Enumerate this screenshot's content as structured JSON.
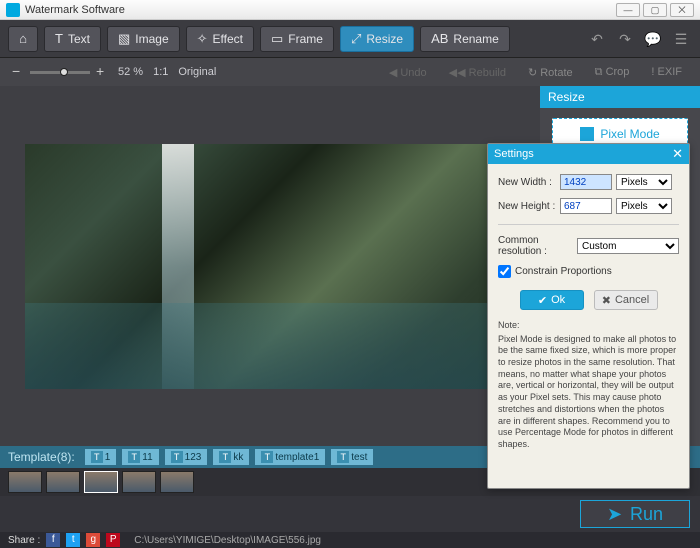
{
  "window": {
    "title": "Watermark Software"
  },
  "toolbar": {
    "text": "Text",
    "image": "Image",
    "effect": "Effect",
    "frame": "Frame",
    "resize": "Resize",
    "rename": "Rename"
  },
  "subbar": {
    "zoom_pct": "52 %",
    "ratio": "1:1",
    "original": "Original",
    "undo": "Undo",
    "rebuild": "Rebuild",
    "rotate": "Rotate",
    "crop": "Crop",
    "exif": "EXIF"
  },
  "sidepanel": {
    "title": "Resize",
    "pixel_mode": "Pixel Mode"
  },
  "settings": {
    "title": "Settings",
    "new_width_label": "New Width :",
    "new_width_value": "1432",
    "new_height_label": "New Height :",
    "new_height_value": "687",
    "unit_pixels": "Pixels",
    "common_res_label": "Common resolution :",
    "common_res_value": "Custom",
    "constrain_label": "Constrain Proportions",
    "constrain_checked": true,
    "ok": "Ok",
    "cancel": "Cancel",
    "note_title": "Note:",
    "note_body": "Pixel Mode is designed to make all photos to be the same fixed size, which is more proper to resize photos in the same resolution. That means, no matter what shape your photos are, vertical or horizontal, they will be output as your Pixel sets. This may cause photo stretches and distortions when the photos are in different shapes.\nRecommend you to use Percentage Mode for photos in different shapes."
  },
  "templates": {
    "label": "Template(8):",
    "items": [
      "1",
      "11",
      "123",
      "kk",
      "template1",
      "test"
    ]
  },
  "run": {
    "label": "Run"
  },
  "status": {
    "share": "Share :",
    "path": "C:\\Users\\YIMIGE\\Desktop\\IMAGE\\556.jpg"
  }
}
